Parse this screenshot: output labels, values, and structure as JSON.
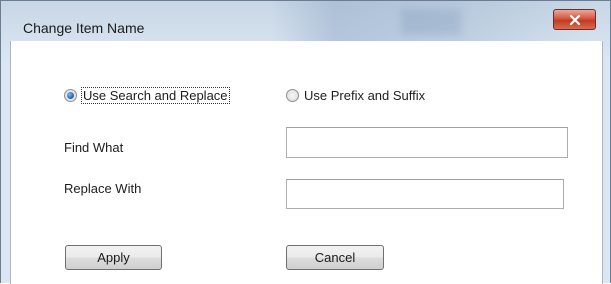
{
  "window": {
    "title": "Change Item Name",
    "close_glyph": "✕"
  },
  "options": {
    "search_replace_label": "Use Search and Replace",
    "search_replace_checked": true,
    "prefix_suffix_label": "Use Prefix and Suffix",
    "prefix_suffix_checked": false
  },
  "fields": {
    "find_label": "Find What",
    "find_value": "",
    "replace_label": "Replace With",
    "replace_value": ""
  },
  "buttons": {
    "apply_label": "Apply",
    "cancel_label": "Cancel"
  },
  "colors": {
    "close_button": "#c94a31",
    "radio_selected": "#1f5fb2"
  }
}
